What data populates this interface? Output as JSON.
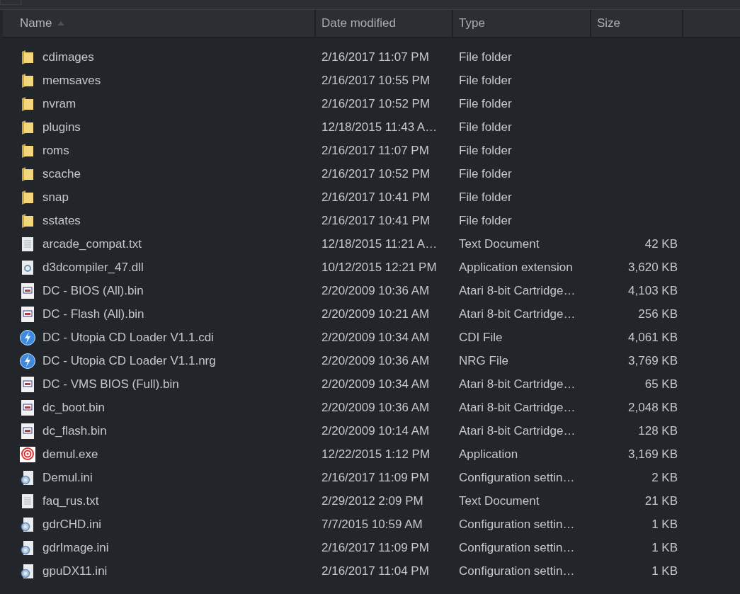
{
  "columns": [
    {
      "label": "Name",
      "sorted": true
    },
    {
      "label": "Date modified",
      "sorted": false
    },
    {
      "label": "Type",
      "sorted": false
    },
    {
      "label": "Size",
      "sorted": false
    }
  ],
  "rows": [
    {
      "kind": "folder",
      "name": "cdimages",
      "date": "2/16/2017 11:07 PM",
      "type": "File folder"
    },
    {
      "kind": "folder",
      "name": "memsaves",
      "date": "2/16/2017 10:55 PM",
      "type": "File folder"
    },
    {
      "kind": "folder",
      "name": "nvram",
      "date": "2/16/2017 10:52 PM",
      "type": "File folder"
    },
    {
      "kind": "folder",
      "name": "plugins",
      "date": "12/18/2015 11:43 A…",
      "type": "File folder"
    },
    {
      "kind": "folder",
      "name": "roms",
      "date": "2/16/2017 11:07 PM",
      "type": "File folder"
    },
    {
      "kind": "folder",
      "name": "scache",
      "date": "2/16/2017 10:52 PM",
      "type": "File folder"
    },
    {
      "kind": "folder",
      "name": "snap",
      "date": "2/16/2017 10:41 PM",
      "type": "File folder"
    },
    {
      "kind": "folder",
      "name": "sstates",
      "date": "2/16/2017 10:41 PM",
      "type": "File folder"
    },
    {
      "kind": "text",
      "name": "arcade_compat.txt",
      "date": "12/18/2015 11:21 A…",
      "type": "Text Document",
      "size": "42 KB"
    },
    {
      "kind": "dll",
      "name": "d3dcompiler_47.dll",
      "date": "10/12/2015 12:21 PM",
      "type": "Application extension",
      "size": "3,620 KB"
    },
    {
      "kind": "bin",
      "name": "DC - BIOS (All).bin",
      "date": "2/20/2009 10:36 AM",
      "type": "Atari 8-bit Cartridge…",
      "size": "4,103 KB"
    },
    {
      "kind": "bin",
      "name": "DC - Flash (All).bin",
      "date": "2/20/2009 10:21 AM",
      "type": "Atari 8-bit Cartridge…",
      "size": "256 KB"
    },
    {
      "kind": "disc",
      "name": "DC - Utopia CD Loader V1.1.cdi",
      "date": "2/20/2009 10:34 AM",
      "type": "CDI File",
      "size": "4,061 KB"
    },
    {
      "kind": "disc",
      "name": "DC - Utopia CD Loader V1.1.nrg",
      "date": "2/20/2009 10:36 AM",
      "type": "NRG File",
      "size": "3,769 KB"
    },
    {
      "kind": "bin",
      "name": "DC - VMS BIOS (Full).bin",
      "date": "2/20/2009 10:34 AM",
      "type": "Atari 8-bit Cartridge…",
      "size": "65 KB"
    },
    {
      "kind": "bin",
      "name": "dc_boot.bin",
      "date": "2/20/2009 10:36 AM",
      "type": "Atari 8-bit Cartridge…",
      "size": "2,048 KB"
    },
    {
      "kind": "bin",
      "name": "dc_flash.bin",
      "date": "2/20/2009 10:14 AM",
      "type": "Atari 8-bit Cartridge…",
      "size": "128 KB"
    },
    {
      "kind": "exe",
      "name": "demul.exe",
      "date": "12/22/2015 1:12 PM",
      "type": "Application",
      "size": "3,169 KB"
    },
    {
      "kind": "ini",
      "name": "Demul.ini",
      "date": "2/16/2017 11:09 PM",
      "type": "Configuration settin…",
      "size": "2 KB"
    },
    {
      "kind": "text",
      "name": "faq_rus.txt",
      "date": "2/29/2012 2:09 PM",
      "type": "Text Document",
      "size": "21 KB"
    },
    {
      "kind": "ini",
      "name": "gdrCHD.ini",
      "date": "7/7/2015 10:59 AM",
      "type": "Configuration settin…",
      "size": "1 KB"
    },
    {
      "kind": "ini",
      "name": "gdrImage.ini",
      "date": "2/16/2017 11:09 PM",
      "type": "Configuration settin…",
      "size": "1 KB"
    },
    {
      "kind": "ini",
      "name": "gpuDX11.ini",
      "date": "2/16/2017 11:04 PM",
      "type": "Configuration settin…",
      "size": "1 KB"
    }
  ]
}
